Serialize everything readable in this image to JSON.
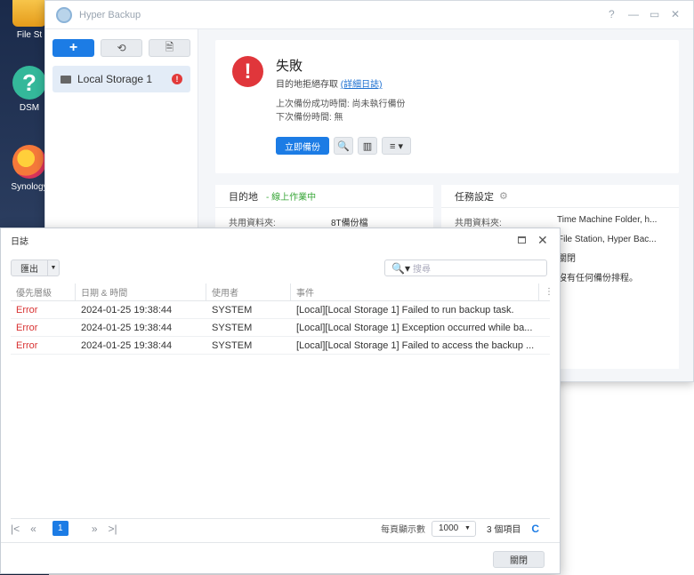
{
  "desktop": {
    "icons": [
      {
        "label": "File St"
      },
      {
        "label": "DSM"
      },
      {
        "label": "Synology"
      }
    ]
  },
  "hyper_backup": {
    "title": "Hyper Backup",
    "controls": {
      "help": "?",
      "minimize": "—",
      "maximize": "▭",
      "close": "✕"
    },
    "toolbar": {
      "add": "+",
      "restore": "⟲",
      "log": "🗎"
    },
    "task": {
      "name": "Local Storage 1",
      "error_badge": "!"
    },
    "status": {
      "icon": "!",
      "title": "失敗",
      "description": "目的地拒絕存取",
      "details_link": "(詳細日誌)",
      "last_success": "上次備份成功時間: 尚未執行備份",
      "next_backup": "下次備份時間: 無",
      "backup_now": "立即備份"
    },
    "destination": {
      "heading": "目的地",
      "online": "- 線上作業中",
      "shared_folder_label": "共用資料夾:",
      "shared_folder_value": "8T備份檔"
    },
    "task_settings": {
      "heading": "任務設定",
      "shared_folder_label": "共用資料夾:",
      "shared_folder_value": "Time Machine Folder, h...",
      "apps_value": "File Station, Hyper Bac...",
      "value3": "關閉",
      "value4": "沒有任何備份排程。"
    }
  },
  "log_dialog": {
    "title": "日誌",
    "export_label": "匯出",
    "search_placeholder": "搜尋",
    "columns": [
      "優先層級",
      "日期 & 時間",
      "使用者",
      "事件"
    ],
    "rows": [
      {
        "level": "Error",
        "datetime": "2024-01-25 19:38:44",
        "user": "SYSTEM",
        "event": "[Local][Local Storage 1] Failed to run backup task."
      },
      {
        "level": "Error",
        "datetime": "2024-01-25 19:38:44",
        "user": "SYSTEM",
        "event": "[Local][Local Storage 1] Exception occurred while ba..."
      },
      {
        "level": "Error",
        "datetime": "2024-01-25 19:38:44",
        "user": "SYSTEM",
        "event": "[Local][Local Storage 1] Failed to access the backup ..."
      }
    ],
    "pager": {
      "first": "|<",
      "prev": "«",
      "current": "1",
      "next": "»",
      "last": ">|",
      "per_page_label": "每頁顯示數",
      "per_page_value": "1000",
      "total": "3 個項目",
      "refresh": "C"
    },
    "close_button": "關閉"
  }
}
